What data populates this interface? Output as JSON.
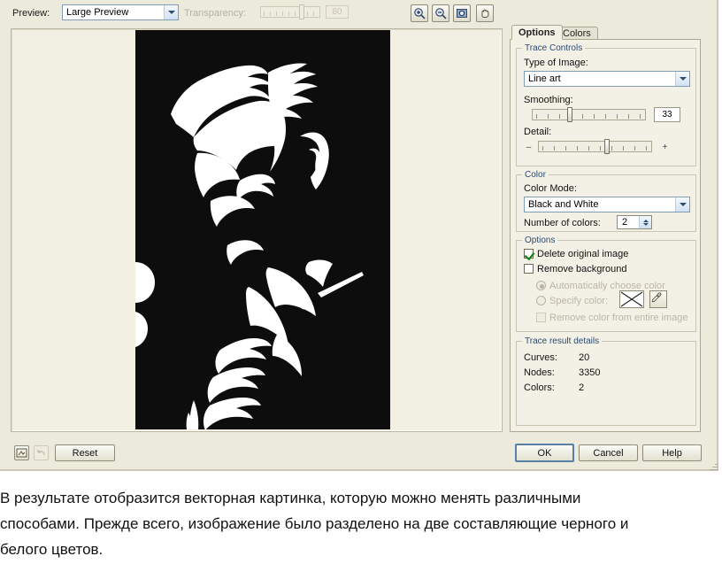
{
  "toolbar": {
    "preview_label": "Preview:",
    "preview_value": "Large Preview",
    "transparency_label": "Transparency:",
    "transparency_value": "80",
    "zoom_in_icon": "zoom-in-icon",
    "zoom_out_icon": "zoom-out-icon",
    "fit_icon": "zoom-fit-icon",
    "pan_icon": "pan-hand-icon"
  },
  "tabs": [
    {
      "label": "Options",
      "active": true
    },
    {
      "label": "Colors",
      "active": false
    }
  ],
  "trace_controls": {
    "group_title": "Trace Controls",
    "type_label": "Type of Image:",
    "type_value": "Line art",
    "smoothing_label": "Smoothing:",
    "smoothing_value": "33",
    "detail_label": "Detail:",
    "detail_minus": "–",
    "detail_plus": "+"
  },
  "color": {
    "group_title": "Color",
    "mode_label": "Color Mode:",
    "mode_value": "Black and White",
    "number_label": "Number of colors:",
    "number_value": "2"
  },
  "options": {
    "group_title": "Options",
    "delete_original_label": "Delete original image",
    "delete_original_checked": true,
    "remove_background_label": "Remove background",
    "remove_background_checked": false,
    "auto_choose_label": "Automatically choose color",
    "auto_choose_selected": true,
    "specify_color_label": "Specify color:",
    "specify_color_selected": false,
    "remove_entire_label": "Remove color from entire image",
    "remove_entire_checked": false,
    "eyedropper_icon": "eyedropper-icon",
    "swatch_icon": "no-color-swatch-icon"
  },
  "trace_result": {
    "group_title": "Trace result details",
    "rows": [
      {
        "label": "Curves:",
        "value": "20"
      },
      {
        "label": "Nodes:",
        "value": "3350"
      },
      {
        "label": "Colors:",
        "value": "2"
      }
    ]
  },
  "bottom": {
    "reset_label": "Reset",
    "ok_label": "OK",
    "cancel_label": "Cancel",
    "help_label": "Help",
    "preview_toggle_icon": "preview-window-icon",
    "undo_icon": "undo-arrow-icon"
  },
  "artwork": {
    "name": "traced-portrait-preview",
    "background_color": "#0d0d0d",
    "foreground_color": "#ffffff"
  },
  "caption": {
    "line1": "В результате отобразится векторная картинка, которую можно менять различными",
    "line2": "способами. Прежде всего, изображение было разделено на две составляющие черного и",
    "line3": "белого цветов."
  }
}
